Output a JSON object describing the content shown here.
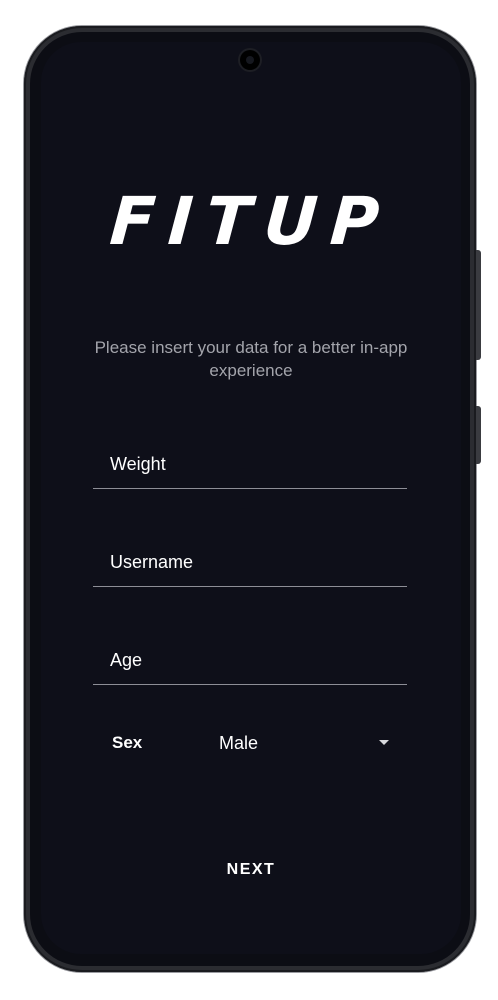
{
  "app": {
    "logo_text": "FITUP",
    "subtitle": "Please insert your data for a better in-app experience"
  },
  "form": {
    "weight": {
      "placeholder": "Weight",
      "value": ""
    },
    "username": {
      "placeholder": "Username",
      "value": ""
    },
    "age": {
      "placeholder": "Age",
      "value": ""
    },
    "sex": {
      "label": "Sex",
      "selected": "Male",
      "dropdown_icon": "dropdown-arrow-icon"
    },
    "next_label": "NEXT"
  },
  "colors": {
    "screen_background": "#0e0f19",
    "text_primary": "#ffffff",
    "text_secondary": "#a3a4ab",
    "divider": "#8d8e96",
    "device_frame": "#2b2c31"
  }
}
